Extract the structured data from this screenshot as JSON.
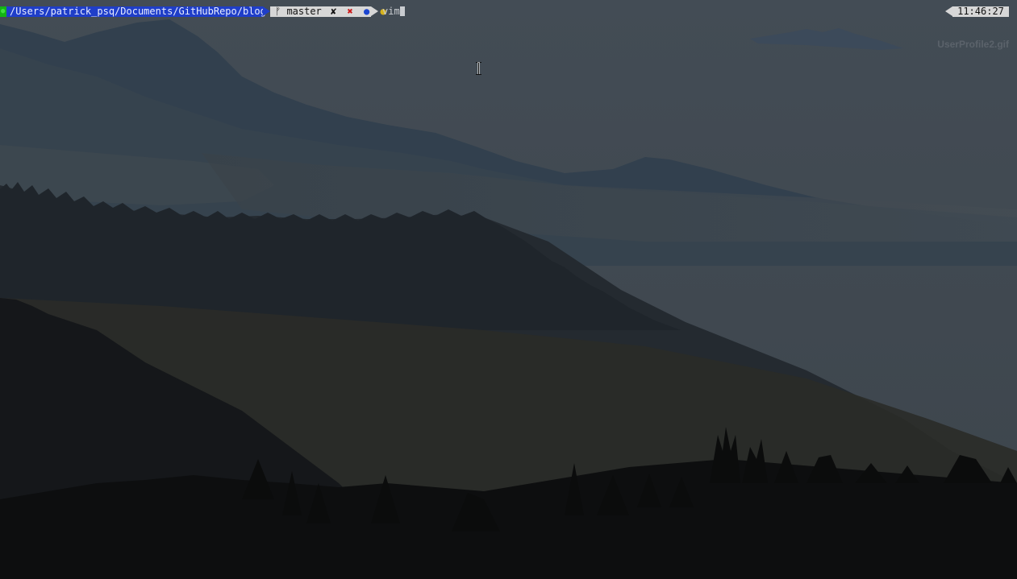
{
  "terminal": {
    "prompt": {
      "path": "/Users/patrick_psq/Documents/GitHubRepo/blog",
      "git_branch": "master",
      "branch_glyph": "ᚠ",
      "dirty_glyph": "✘",
      "staged_glyph": "✖",
      "unstaged_glyph": "●",
      "untracked_glyph": "●",
      "status_glyph": "●",
      "command": "vim",
      "clock": "11:46:27"
    },
    "colors": {
      "path_bg": "#1f3ec9",
      "git_bg": "#d7d7d7",
      "status_ok": "#14b414",
      "staged": "#cc1a1a",
      "unstaged": "#1b45d0",
      "untracked": "#d6b21a"
    }
  },
  "overlay": {
    "watermark": "UserProfile2.gif"
  },
  "pointer": {
    "icon": "text-cursor-icon"
  }
}
